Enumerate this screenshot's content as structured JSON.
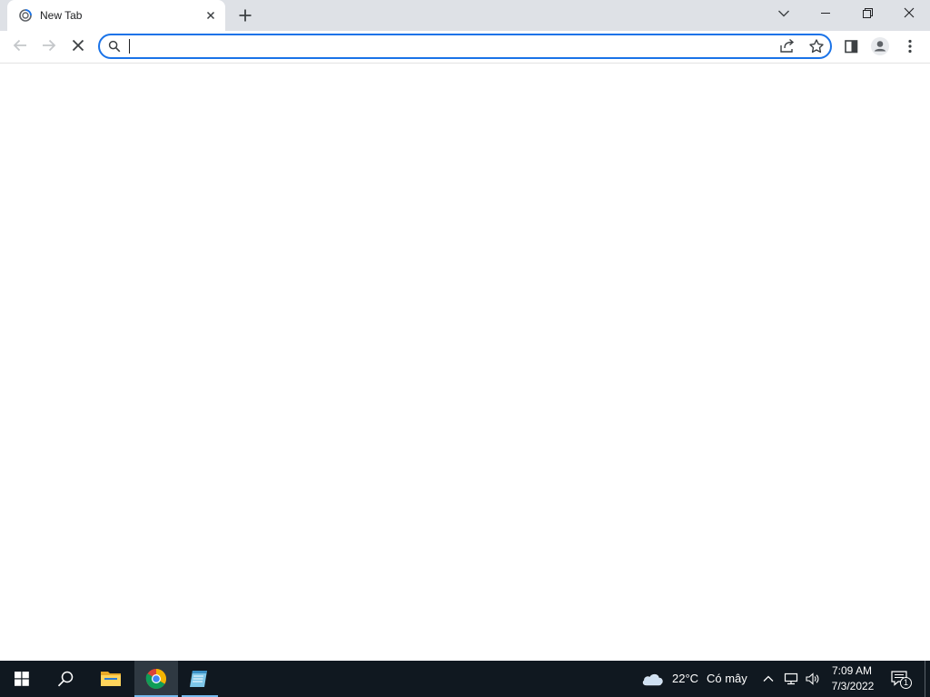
{
  "browser": {
    "tab": {
      "title": "New Tab",
      "favicon": "loading-spinner-icon"
    },
    "new_tab_icon": "plus-icon",
    "tab_search_icon": "chevron-down-icon",
    "window_controls": [
      "minimize-icon",
      "restore-icon",
      "close-icon"
    ],
    "toolbar": {
      "back_icon": "arrow-left-icon",
      "forward_icon": "arrow-right-icon",
      "stop_icon": "close-icon"
    },
    "omnibox": {
      "value": "",
      "placeholder": "",
      "focused": true,
      "search_icon": "search-icon",
      "share_icon": "share-icon",
      "bookmark_icon": "star-icon"
    },
    "right_icons": [
      "side-panel-icon",
      "profile-icon",
      "kebab-menu-icon"
    ]
  },
  "taskbar": {
    "pinned": [
      {
        "name": "start",
        "icon": "windows-logo-icon"
      },
      {
        "name": "search",
        "icon": "search-icon"
      },
      {
        "name": "file-explorer",
        "icon": "folder-icon"
      },
      {
        "name": "chrome",
        "icon": "chrome-icon",
        "active": true
      },
      {
        "name": "app",
        "icon": "notepad-icon"
      }
    ],
    "weather": {
      "temperature": "22°C",
      "description": "Có mây",
      "icon": "cloud-icon"
    },
    "tray_icons": [
      "chevron-up-icon",
      "network-icon",
      "volume-icon"
    ],
    "clock": {
      "time": "7:09 AM",
      "date": "7/3/2022"
    },
    "notifications": {
      "count": "1",
      "icon": "notification-icon"
    }
  },
  "colors": {
    "tabstrip_bg": "#dee1e6",
    "omnibox_focus_ring": "#1a73e8",
    "taskbar_bg": "#101820",
    "taskbar_active_indicator": "#76b9ed"
  }
}
